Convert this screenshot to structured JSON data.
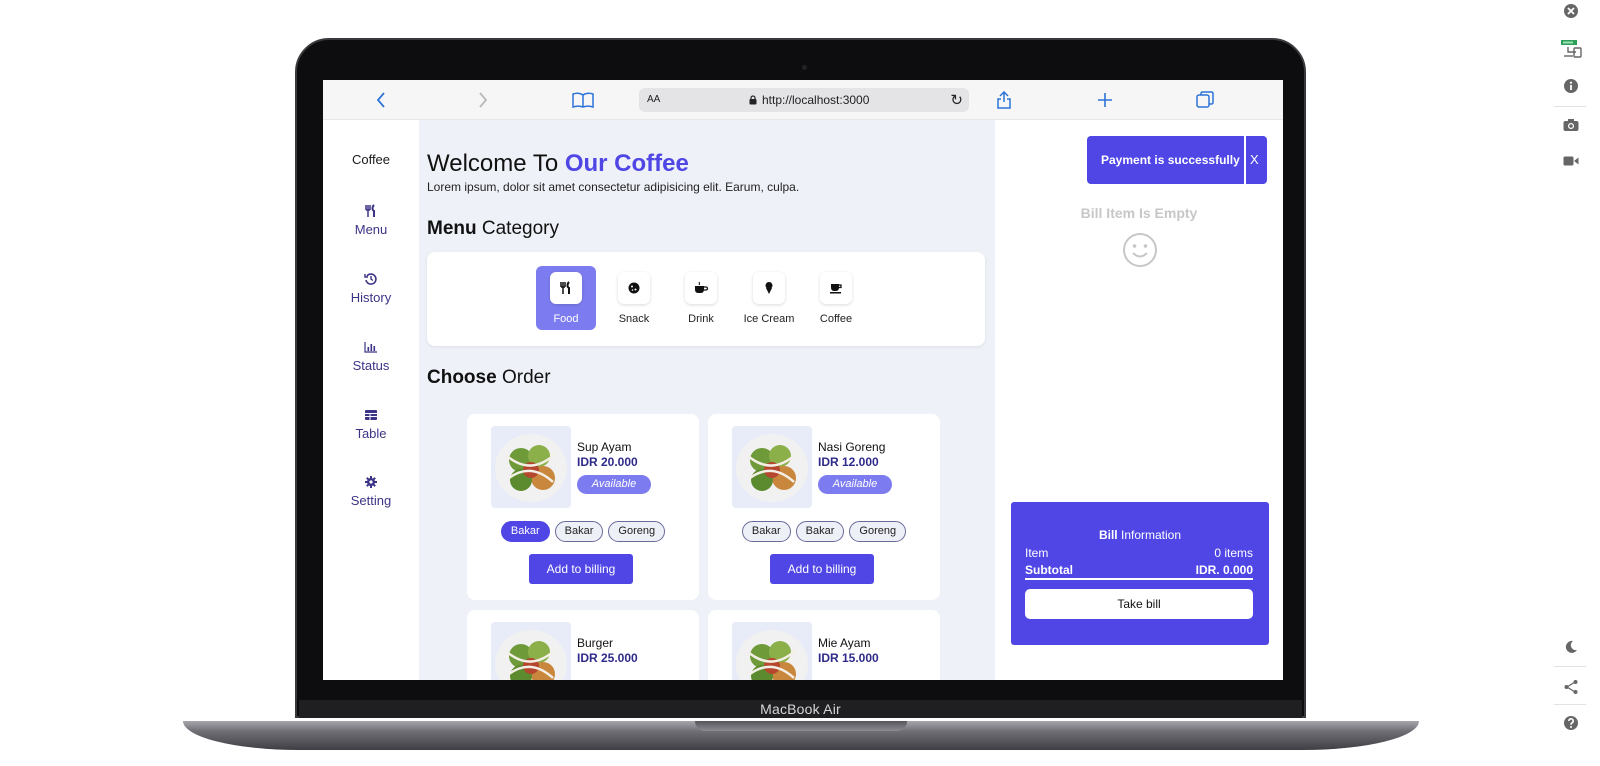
{
  "device": {
    "label": "MacBook Air"
  },
  "browser": {
    "reader_label": "AA",
    "url": "http://localhost:3000"
  },
  "sidebar": {
    "brand": "Coffee",
    "items": [
      {
        "label": "Menu",
        "icon": "utensils-icon"
      },
      {
        "label": "History",
        "icon": "history-icon"
      },
      {
        "label": "Status",
        "icon": "bar-chart-icon"
      },
      {
        "label": "Table",
        "icon": "table-icon"
      },
      {
        "label": "Setting",
        "icon": "gear-icon"
      }
    ]
  },
  "header": {
    "welcome_prefix": "Welcome To",
    "welcome_brand": "Our Coffee",
    "subtitle": "Lorem ipsum, dolor sit amet consectetur adipisicing elit. Earum, culpa."
  },
  "menu_section": {
    "bold": "Menu",
    "rest": "Category"
  },
  "categories": [
    {
      "label": "Food",
      "icon": "utensils-icon",
      "active": true
    },
    {
      "label": "Snack",
      "icon": "cookie-icon",
      "active": false
    },
    {
      "label": "Drink",
      "icon": "mug-icon",
      "active": false
    },
    {
      "label": "Ice Cream",
      "icon": "ice-cream-icon",
      "active": false
    },
    {
      "label": "Coffee",
      "icon": "coffee-icon",
      "active": false
    }
  ],
  "order_section": {
    "bold": "Choose",
    "rest": "Order"
  },
  "products": [
    {
      "name": "Sup Ayam",
      "price": "IDR 20.000",
      "status": "Available",
      "options": [
        "Bakar",
        "Bakar",
        "Goreng"
      ],
      "selected_option": 0,
      "button": "Add to billing"
    },
    {
      "name": "Nasi Goreng",
      "price": "IDR 12.000",
      "status": "Available",
      "options": [
        "Bakar",
        "Bakar",
        "Goreng"
      ],
      "selected_option": -1,
      "button": "Add to billing"
    },
    {
      "name": "Burger",
      "price": "IDR 25.000"
    },
    {
      "name": "Mie Ayam",
      "price": "IDR 15.000"
    }
  ],
  "toast": {
    "message": "Payment is successfully",
    "close": "X"
  },
  "bill": {
    "empty_text": "Bill Item Is Empty",
    "title_bold": "Bill",
    "title_rest": "Information",
    "item_label": "Item",
    "item_value": "0 items",
    "subtotal_label": "Subtotal",
    "subtotal_value": "IDR. 0.000",
    "take_bill": "Take bill"
  },
  "colors": {
    "accent": "#4f46e5",
    "accent_light": "#7c7cf0",
    "main_bg": "#eef1f7",
    "nav_text": "#3b3486"
  }
}
